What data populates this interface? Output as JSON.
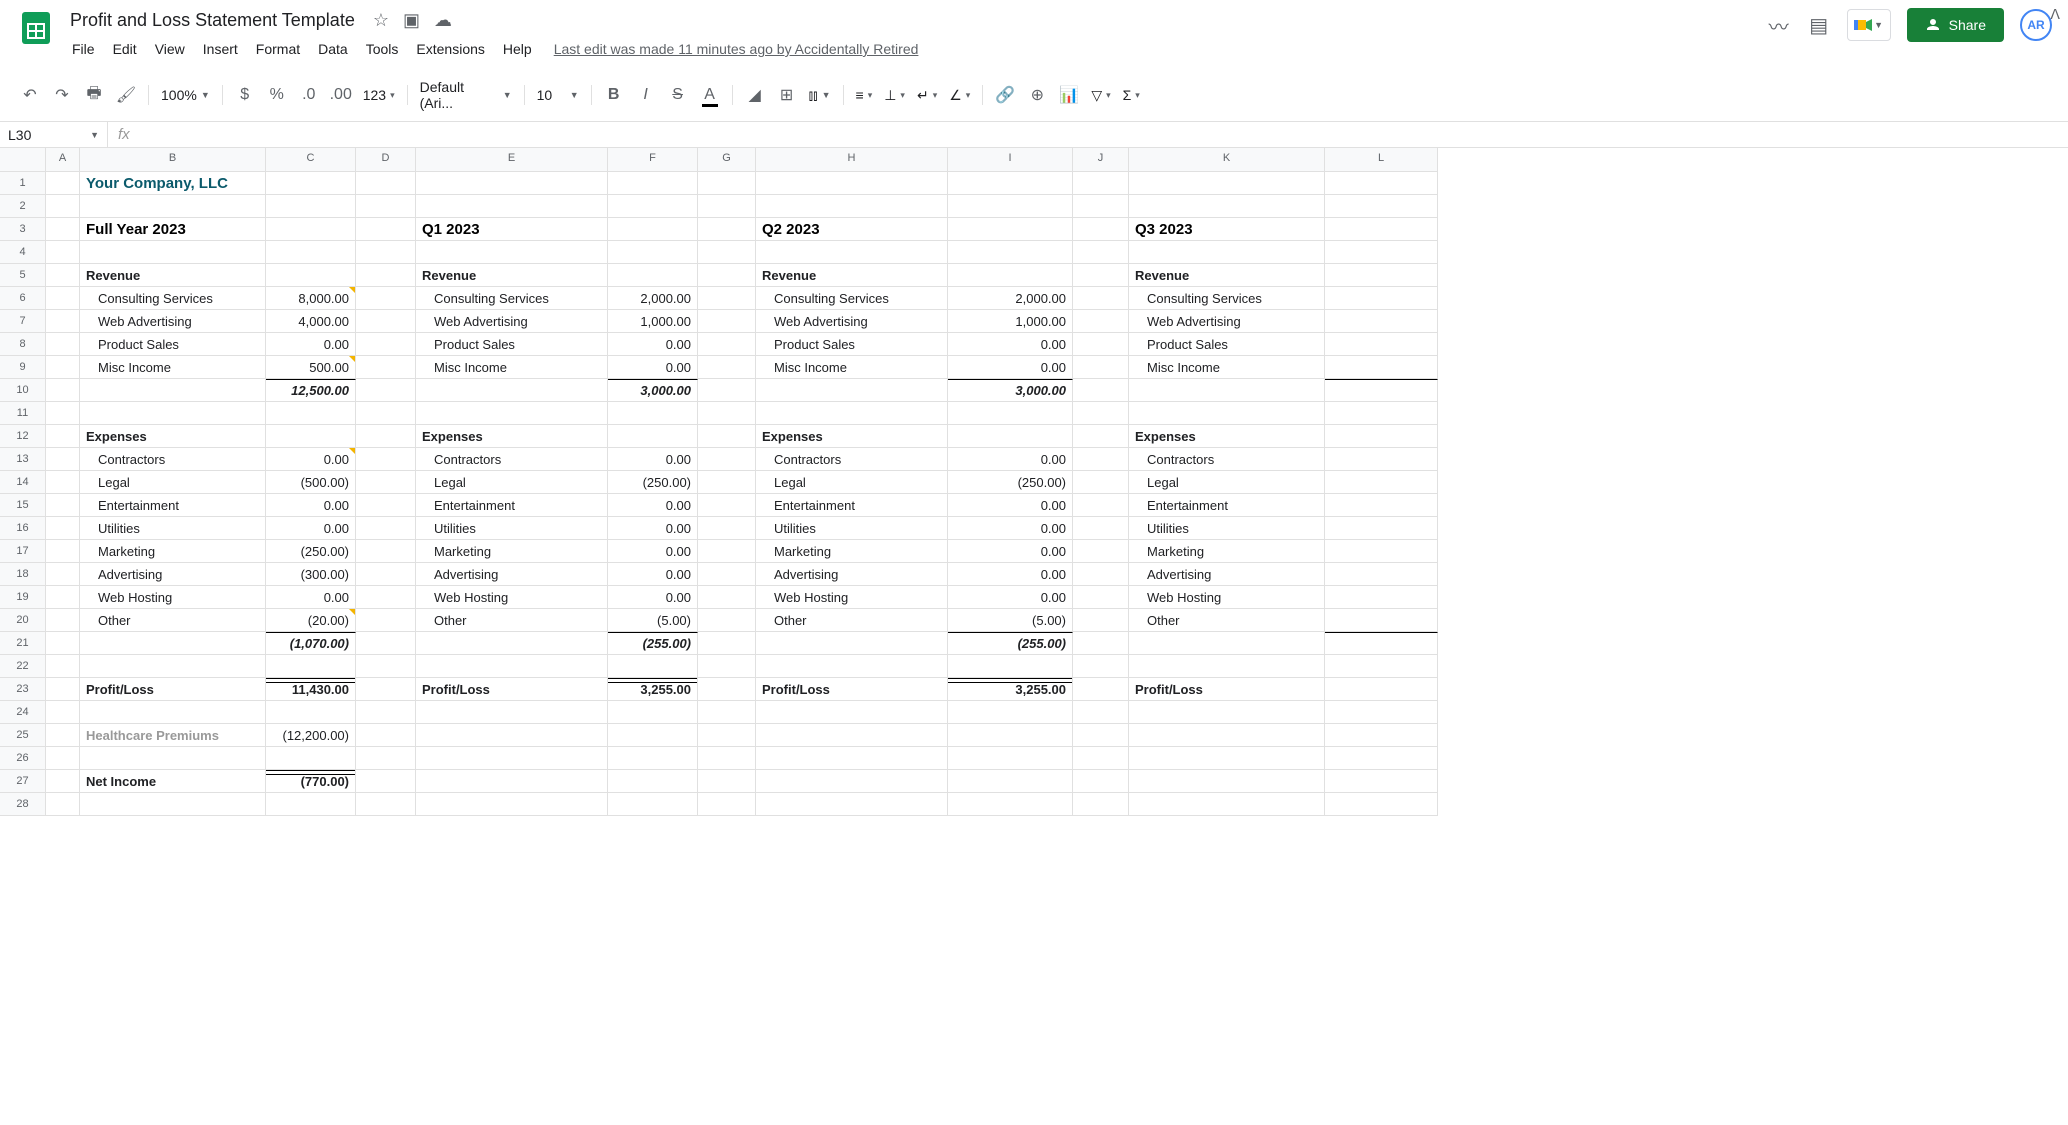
{
  "doc": {
    "title": "Profit and Loss Statement Template",
    "lastEdit": "Last edit was made 11 minutes ago by Accidentally Retired"
  },
  "menus": [
    "File",
    "Edit",
    "View",
    "Insert",
    "Format",
    "Data",
    "Tools",
    "Extensions",
    "Help"
  ],
  "toolbar": {
    "zoom": "100%",
    "font": "Default (Ari...",
    "fontSize": "10"
  },
  "share": "Share",
  "avatar": "AR",
  "namebox": "L30",
  "cols": [
    "A",
    "B",
    "C",
    "D",
    "E",
    "F",
    "G",
    "H",
    "I",
    "J",
    "K",
    "L"
  ],
  "rows": 28,
  "company": "Your Company, LLC",
  "periods": {
    "full": "Full Year 2023",
    "q1": "Q1 2023",
    "q2": "Q2 2023",
    "q3": "Q3 2023"
  },
  "labels": {
    "revenue": "Revenue",
    "expenses": "Expenses",
    "profitloss": "Profit/Loss",
    "healthcare": "Healthcare Premiums",
    "netincome": "Net Income",
    "rev_items": [
      "Consulting Services",
      "Web Advertising",
      "Product Sales",
      "Misc Income"
    ],
    "exp_items": [
      "Contractors",
      "Legal",
      "Entertainment",
      "Utilities",
      "Marketing",
      "Advertising",
      "Web Hosting",
      "Other"
    ]
  },
  "vals": {
    "full": {
      "rev": [
        "8,000.00",
        "4,000.00",
        "0.00",
        "500.00"
      ],
      "rev_total": "12,500.00",
      "exp": [
        "0.00",
        "(500.00)",
        "0.00",
        "0.00",
        "(250.00)",
        "(300.00)",
        "0.00",
        "(20.00)"
      ],
      "exp_total": "(1,070.00)",
      "pl": "11,430.00",
      "healthcare": "(12,200.00)",
      "net": "(770.00)"
    },
    "q1": {
      "rev": [
        "2,000.00",
        "1,000.00",
        "0.00",
        "0.00"
      ],
      "rev_total": "3,000.00",
      "exp": [
        "0.00",
        "(250.00)",
        "0.00",
        "0.00",
        "0.00",
        "0.00",
        "0.00",
        "(5.00)"
      ],
      "exp_total": "(255.00)",
      "pl": "3,255.00"
    },
    "q2": {
      "rev": [
        "2,000.00",
        "1,000.00",
        "0.00",
        "0.00"
      ],
      "rev_total": "3,000.00",
      "exp": [
        "0.00",
        "(250.00)",
        "0.00",
        "0.00",
        "0.00",
        "0.00",
        "0.00",
        "(5.00)"
      ],
      "exp_total": "(255.00)",
      "pl": "3,255.00"
    }
  }
}
